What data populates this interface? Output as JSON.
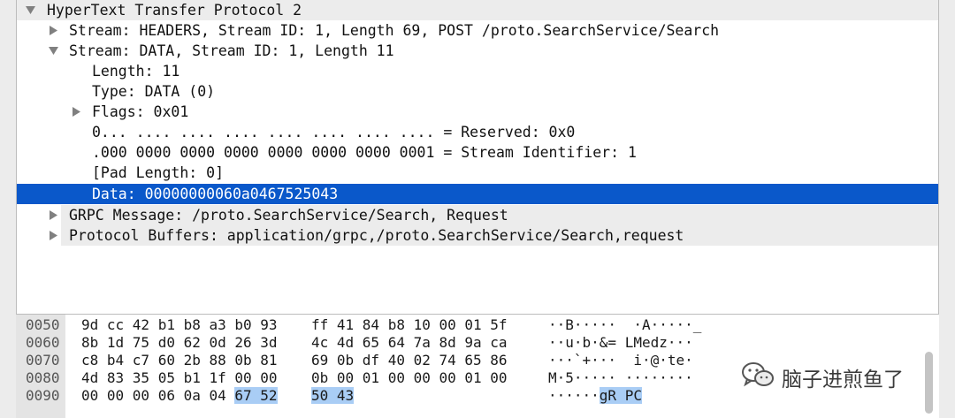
{
  "tree": {
    "rows": [
      {
        "text": "HyperText Transfer Protocol 2",
        "expanded": true
      },
      {
        "text": "Stream: HEADERS, Stream ID: 1, Length 69, POST /proto.SearchService/Search",
        "expanded": false
      },
      {
        "text": "Stream: DATA, Stream ID: 1, Length 11",
        "expanded": true
      },
      {
        "text": "Length: 11"
      },
      {
        "text": "Type: DATA (0)"
      },
      {
        "text": "Flags: 0x01",
        "expanded": false
      },
      {
        "text": "0... .... .... .... .... .... .... .... = Reserved: 0x0"
      },
      {
        "text": ".000 0000 0000 0000 0000 0000 0000 0001 = Stream Identifier: 1"
      },
      {
        "text": "[Pad Length: 0]"
      },
      {
        "text": "Data: 00000000060a0467525043",
        "selected": true
      },
      {
        "text": "GRPC Message: /proto.SearchService/Search, Request",
        "expanded": false
      },
      {
        "text": "Protocol Buffers: application/grpc,/proto.SearchService/Search,request",
        "expanded": false
      }
    ]
  },
  "bytes": {
    "rows": [
      {
        "offset": "0050",
        "hex1": "9d cc 42 b1 b8 a3 b0 93",
        "hex2": "ff 41 84 b8 10 00 01 5f",
        "ascii": "··B·····  ·A·····_"
      },
      {
        "offset": "0060",
        "hex1": "8b 1d 75 d0 62 0d 26 3d",
        "hex2": "4c 4d 65 64 7a 8d 9a ca",
        "ascii": "··u·b·&= LMedz···"
      },
      {
        "offset": "0070",
        "hex1": "c8 b4 c7 60 2b 88 0b 81",
        "hex2": "69 0b df 40 02 74 65 86",
        "ascii": "···`+···  i·@·te·"
      },
      {
        "offset": "0080",
        "hex1": "4d 83 35 05 b1 1f 00 00",
        "hex2": "0b 00 01 00 00 00 01 00",
        "ascii": "M·5····· ········"
      },
      {
        "offset": "0090",
        "hex1_plain": "00 00 00 06 0a 04 ",
        "hex1_hl": "67 52",
        "hex2": "50 43",
        "ascii_plain": "······",
        "ascii_hl": "gR PC"
      }
    ]
  },
  "watermark": {
    "text": "脑子进煎鱼了",
    "icon": "wechat-icon"
  },
  "colors": {
    "selection": "#0a58ca",
    "highlight": "#a9cdf5",
    "band": "#ececec"
  }
}
